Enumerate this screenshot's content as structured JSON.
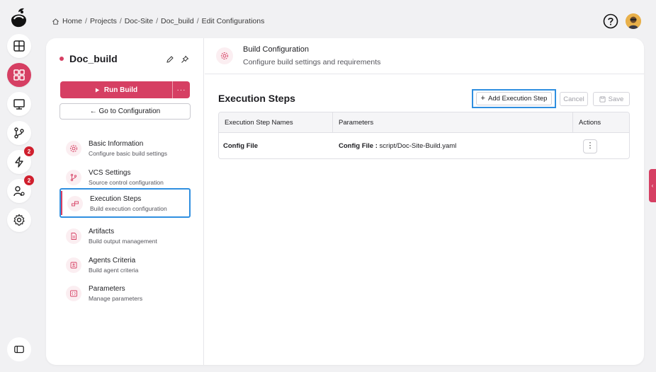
{
  "breadcrumb": {
    "items": [
      "Home",
      "Projects",
      "Doc-Site",
      "Doc_build",
      "Edit Configurations"
    ]
  },
  "rail": {
    "badges": {
      "releases": "2",
      "users": "2"
    }
  },
  "sidebar": {
    "build_name": "Doc_build",
    "run_label": "Run Build",
    "more_label": "···",
    "goto_label": "← Go to Configuration",
    "items": [
      {
        "title": "Basic Information",
        "subtitle": "Configure basic build settings"
      },
      {
        "title": "VCS Settings",
        "subtitle": "Source control configuration"
      },
      {
        "title": "Execution Steps",
        "subtitle": "Build execution configuration"
      },
      {
        "title": "Artifacts",
        "subtitle": "Build output management"
      },
      {
        "title": "Agents Criteria",
        "subtitle": "Build agent criteria"
      },
      {
        "title": "Parameters",
        "subtitle": "Manage parameters"
      }
    ]
  },
  "header": {
    "title": "Build Configuration",
    "subtitle": "Configure build settings and requirements"
  },
  "main": {
    "section_title": "Execution Steps",
    "add_label": "Add Execution Step",
    "cancel_label": "Cancel",
    "save_label": "Save",
    "table": {
      "columns": [
        "Execution Step Names",
        "Parameters",
        "Actions"
      ],
      "rows": [
        {
          "name": "Config File",
          "param_key": "Config File :",
          "param_value": "script/Doc-Site-Build.yaml",
          "action": "⋮"
        }
      ]
    }
  },
  "colors": {
    "accent": "#d63f63",
    "highlight": "#2f8fe0"
  }
}
